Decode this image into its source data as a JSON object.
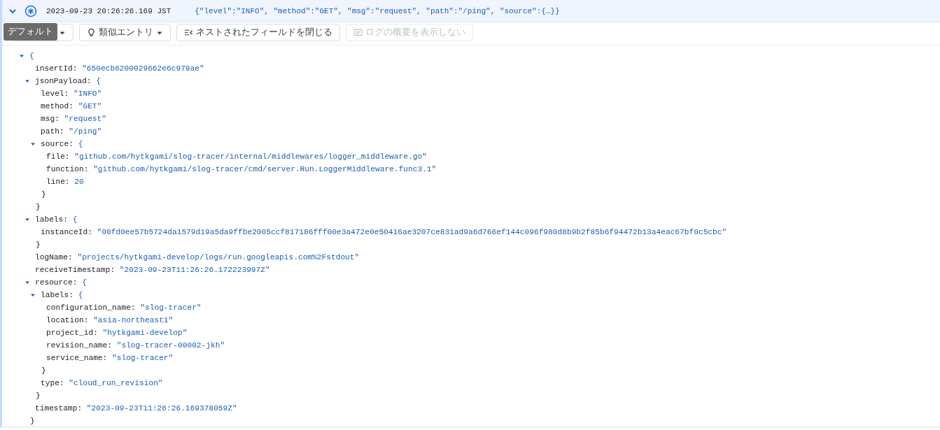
{
  "entry": {
    "expanded": true,
    "timestamp": "2023-09-23 20:26:26.169 JST",
    "summary": "{\"level\":\"INFO\", \"method\":\"GET\", \"msg\":\"request\", \"path\":\"/ping\", \"source\":{…}}"
  },
  "toolbar": {
    "tooltip": "デフォルト",
    "buttons": [
      {
        "kind": "dropdown",
        "disabled": false
      },
      {
        "kind": "similar",
        "label": "類似エントリ",
        "disabled": false
      },
      {
        "kind": "collapse",
        "label": "ネストされたフィールドを閉じる",
        "disabled": false
      },
      {
        "kind": "summary",
        "label": "ログの概要を表示しない",
        "disabled": true
      }
    ]
  },
  "tree": {
    "open": "{",
    "close": "}",
    "expanded": true,
    "children": [
      {
        "key": "insertId:",
        "value": "\"650ecb6200029662e6c979ae\""
      },
      {
        "key": "jsonPayload:",
        "open": "{",
        "close": "}",
        "expanded": true,
        "children": [
          {
            "key": "level:",
            "value": "\"INFO\""
          },
          {
            "key": "method:",
            "value": "\"GET\""
          },
          {
            "key": "msg:",
            "value": "\"request\""
          },
          {
            "key": "path:",
            "value": "\"/ping\""
          },
          {
            "key": "source:",
            "open": "{",
            "close": "}",
            "expanded": true,
            "children": [
              {
                "key": "file:",
                "value": "\"github.com/hytkgami/slog-tracer/internal/middlewares/logger_middleware.go\""
              },
              {
                "key": "function:",
                "value": "\"github.com/hytkgami/slog-tracer/cmd/server.Run.LoggerMiddleware.func3.1\""
              },
              {
                "key": "line:",
                "value": "20"
              }
            ]
          }
        ]
      },
      {
        "key": "labels:",
        "open": "{",
        "close": "}",
        "expanded": true,
        "children": [
          {
            "key": "instanceId:",
            "value": "\"00fd0ee57b5724da1579d19a5da9ffbe2005ccf817186fff00e3a472e0e50416ae3207ce831ad9a6d766ef144c096f980d8b9b2f85b6f94472b13a4eac67bf0c5cbc\""
          }
        ]
      },
      {
        "key": "logName:",
        "value": "\"projects/hytkgami-develop/logs/run.googleapis.com%2Fstdout\""
      },
      {
        "key": "receiveTimestamp:",
        "value": "\"2023-09-23T11:26:26.172223997Z\""
      },
      {
        "key": "resource:",
        "open": "{",
        "close": "}",
        "expanded": true,
        "children": [
          {
            "key": "labels:",
            "open": "{",
            "close": "}",
            "expanded": true,
            "children": [
              {
                "key": "configuration_name:",
                "value": "\"slog-tracer\""
              },
              {
                "key": "location:",
                "value": "\"asia-northeast1\""
              },
              {
                "key": "project_id:",
                "value": "\"hytkgami-develop\""
              },
              {
                "key": "revision_name:",
                "value": "\"slog-tracer-00002-jkh\""
              },
              {
                "key": "service_name:",
                "value": "\"slog-tracer\""
              }
            ]
          },
          {
            "key": "type:",
            "value": "\"cloud_run_revision\""
          }
        ]
      },
      {
        "key": "timestamp:",
        "value": "\"2023-09-23T11:26:26.169378059Z\""
      }
    ]
  }
}
